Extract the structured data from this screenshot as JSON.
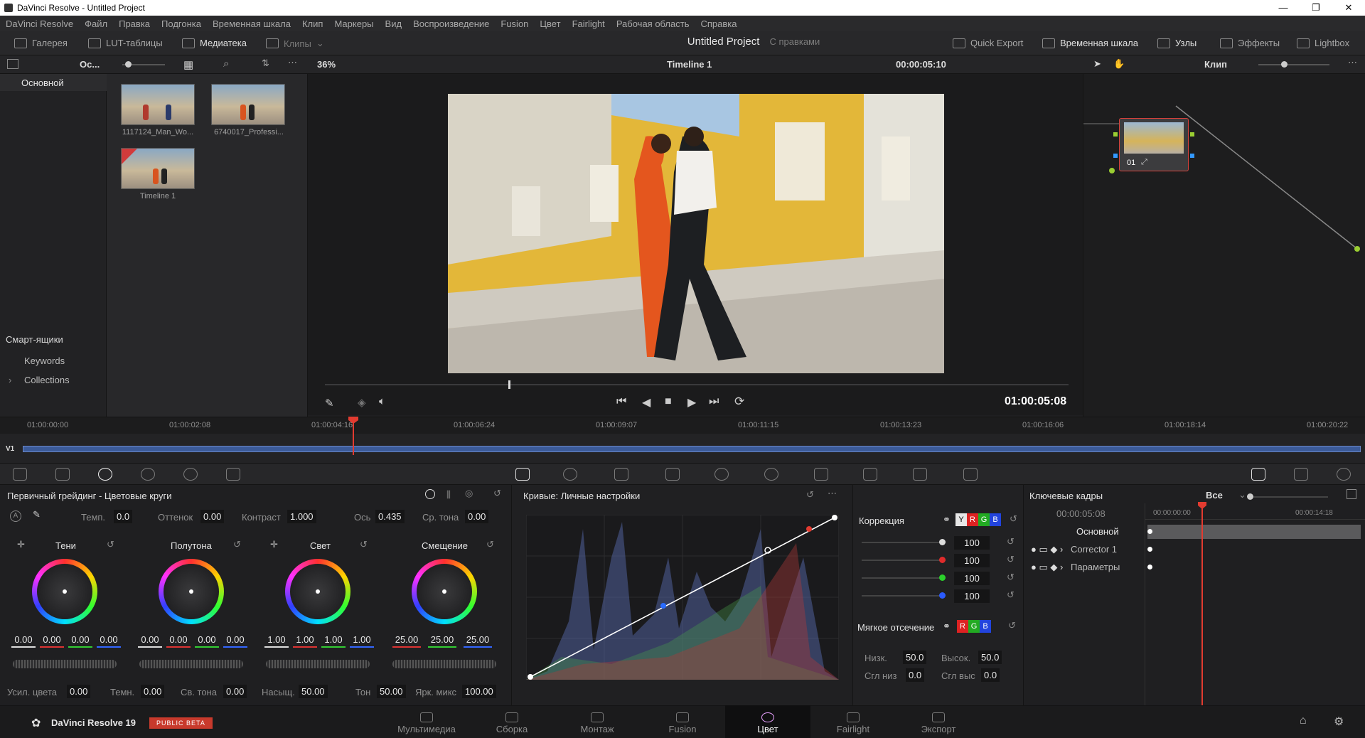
{
  "window": {
    "title": "DaVinci Resolve - Untitled Project",
    "min": "—",
    "max": "❐",
    "close": "✕"
  },
  "menu": [
    "DaVinci Resolve",
    "Файл",
    "Правка",
    "Подгонка",
    "Временная шкала",
    "Клип",
    "Маркеры",
    "Вид",
    "Воспроизведение",
    "Fusion",
    "Цвет",
    "Fairlight",
    "Рабочая область",
    "Справка"
  ],
  "toolbar": {
    "gallery": "Галерея",
    "luts": "LUT-таблицы",
    "media": "Медиатека",
    "clips": "Клипы",
    "project": "Untitled Project",
    "project_sub": "С правками",
    "quick_export": "Quick Export",
    "timeline": "Временная шкала",
    "nodes": "Узлы",
    "effects": "Эффекты",
    "lightbox": "Lightbox"
  },
  "subbar": {
    "bin_short": "Ос...",
    "zoom": "36%",
    "timeline_name": "Timeline 1",
    "timecode": "00:00:05:10",
    "clip_mode": "Клип"
  },
  "leftpanel": {
    "master": "Основной",
    "smart_bins": "Смарт-ящики",
    "keywords": "Keywords",
    "collections": "Collections"
  },
  "bins": [
    {
      "label": "1117124_Man_Wo..."
    },
    {
      "label": "6740017_Professi..."
    },
    {
      "label": "Timeline 1"
    }
  ],
  "viewer": {
    "timecode": "01:00:05:08"
  },
  "ruler": [
    "01:00:00:00",
    "01:00:02:08",
    "01:00:04:16",
    "01:00:06:24",
    "01:00:09:07",
    "01:00:11:15",
    "01:00:13:23",
    "01:00:16:06",
    "01:00:18:14",
    "01:00:20:22"
  ],
  "track": {
    "label": "V1"
  },
  "primary": {
    "title": "Первичный грейдинг - Цветовые круги",
    "temp_lbl": "Темп.",
    "temp": "0.0",
    "tint_lbl": "Оттенок",
    "tint": "0.00",
    "contrast_lbl": "Контраст",
    "contrast": "1.000",
    "pivot_lbl": "Ось",
    "pivot": "0.435",
    "md_lbl": "Ср. тона",
    "md": "0.00",
    "wheels": [
      {
        "name": "Тени",
        "vals": [
          "0.00",
          "0.00",
          "0.00",
          "0.00"
        ]
      },
      {
        "name": "Полутона",
        "vals": [
          "0.00",
          "0.00",
          "0.00",
          "0.00"
        ]
      },
      {
        "name": "Свет",
        "vals": [
          "1.00",
          "1.00",
          "1.00",
          "1.00"
        ]
      },
      {
        "name": "Смещение",
        "vals": [
          "25.00",
          "25.00",
          "25.00"
        ]
      }
    ],
    "boost_lbl": "Усил. цвета",
    "boost": "0.00",
    "shadow_lbl": "Темн.",
    "shadow": "0.00",
    "hl_lbl": "Св. тона",
    "hl": "0.00",
    "sat_lbl": "Насыщ.",
    "sat": "50.00",
    "hue_lbl": "Тон",
    "hue": "50.00",
    "lummix_lbl": "Ярк. микс",
    "lummix": "100.00"
  },
  "curves": {
    "title": "Кривые: Личные настройки"
  },
  "correction": {
    "title": "Коррекция",
    "values": [
      "100",
      "100",
      "100",
      "100"
    ],
    "soft_clip": "Мягкое отсечение",
    "low_lbl": "Низк.",
    "low": "50.0",
    "high_lbl": "Высок.",
    "high": "50.0",
    "ls_lbl": "Сгл низ",
    "ls": "0.0",
    "hs_lbl": "Сгл выс",
    "hs": "0.0",
    "chips": [
      "Y",
      "R",
      "G",
      "B"
    ]
  },
  "keyframes": {
    "title": "Ключевые кадры",
    "filter": "Все",
    "timecode": "00:00:05:08",
    "start": "00:00:00:00",
    "end": "00:00:14:18",
    "rows": [
      "Основной",
      "Corrector 1",
      "Параметры"
    ]
  },
  "node": {
    "label": "01"
  },
  "bottom": {
    "app": "DaVinci Resolve 19",
    "badge": "PUBLIC BETA",
    "pages": [
      "Мультимедиа",
      "Сборка",
      "Монтаж",
      "Fusion",
      "Цвет",
      "Fairlight",
      "Экспорт"
    ]
  }
}
